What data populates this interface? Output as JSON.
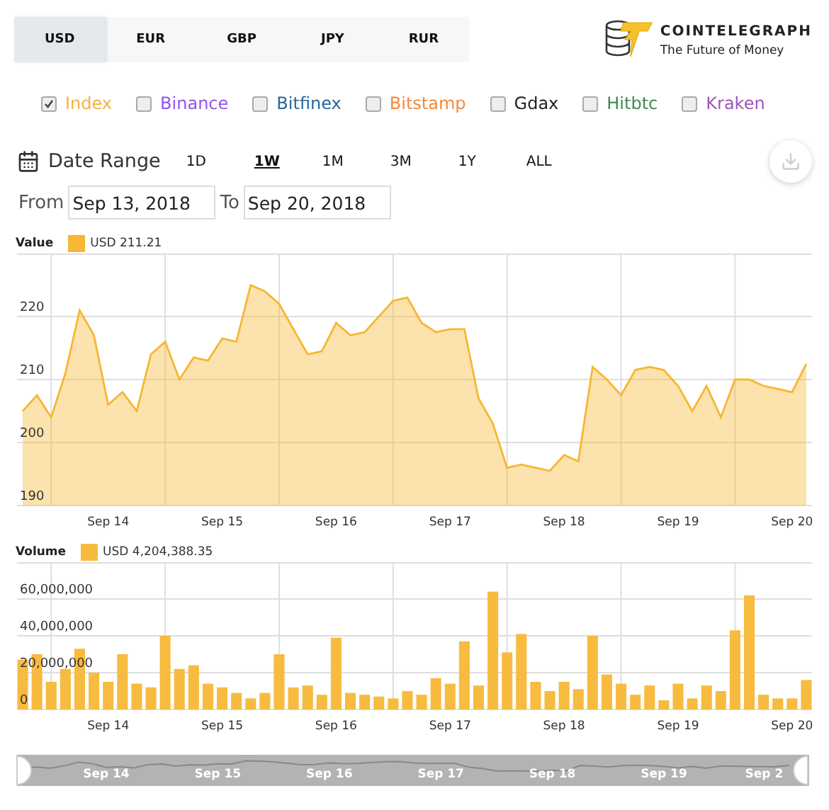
{
  "currency_tabs": [
    {
      "label": "USD",
      "selected": true
    },
    {
      "label": "EUR",
      "selected": false
    },
    {
      "label": "GBP",
      "selected": false
    },
    {
      "label": "JPY",
      "selected": false
    },
    {
      "label": "RUR",
      "selected": false
    }
  ],
  "logo": {
    "name": "COINTELEGRAPH",
    "tagline": "The Future of Money"
  },
  "exchanges": [
    {
      "label": "Index",
      "checked": true,
      "color": "#f6b042"
    },
    {
      "label": "Binance",
      "checked": false,
      "color": "#9353f0"
    },
    {
      "label": "Bitfinex",
      "checked": false,
      "color": "#2a679c"
    },
    {
      "label": "Bitstamp",
      "checked": false,
      "color": "#f5883b"
    },
    {
      "label": "Gdax",
      "checked": false,
      "color": "#222222"
    },
    {
      "label": "Hitbtc",
      "checked": false,
      "color": "#3d8b4b"
    },
    {
      "label": "Kraken",
      "checked": false,
      "color": "#9c58b8"
    }
  ],
  "date_range": {
    "label": "Date Range",
    "ranges": [
      {
        "label": "1D",
        "selected": false
      },
      {
        "label": "1W",
        "selected": true
      },
      {
        "label": "1M",
        "selected": false
      },
      {
        "label": "3M",
        "selected": false
      },
      {
        "label": "1Y",
        "selected": false
      },
      {
        "label": "ALL",
        "selected": false
      }
    ],
    "from_label": "From",
    "from": "Sep 13, 2018",
    "to_label": "To",
    "to": "Sep 20, 2018"
  },
  "value_chart": {
    "title": "Value",
    "reading": "211.21",
    "chart_data": {
      "type": "area",
      "grid": true,
      "ylim": [
        190,
        230
      ],
      "yticks": [
        190,
        200,
        210,
        220
      ],
      "categories": [
        null,
        null,
        null,
        null,
        null,
        null,
        "Sep 14",
        null,
        null,
        null,
        null,
        null,
        null,
        null,
        "Sep 15",
        null,
        null,
        null,
        null,
        null,
        null,
        null,
        "Sep 16",
        null,
        null,
        null,
        null,
        null,
        null,
        null,
        "Sep 17",
        null,
        null,
        null,
        null,
        null,
        null,
        null,
        "Sep 18",
        null,
        null,
        null,
        null,
        null,
        null,
        null,
        "Sep 19",
        null,
        null,
        null,
        null,
        null,
        null,
        null,
        "Sep 20",
        null
      ],
      "series": [
        {
          "name": "USD",
          "color": "#f7b733",
          "values": [
            205,
            207.5,
            204,
            211,
            221,
            217,
            206,
            208,
            205,
            214,
            216,
            210,
            213.5,
            213,
            216.5,
            216,
            225,
            224,
            222,
            218,
            214,
            214.5,
            219,
            217,
            217.5,
            220,
            222.5,
            223,
            219,
            217.5,
            218,
            218,
            207,
            203,
            196,
            196.5,
            196,
            195.5,
            198,
            197,
            212,
            210,
            207.5,
            211.5,
            212,
            211.5,
            209,
            205,
            209,
            204,
            210,
            210,
            209,
            208.5,
            208,
            212.5
          ]
        }
      ]
    }
  },
  "volume_chart": {
    "title": "Volume",
    "reading": "4,204,388.35",
    "chart_data": {
      "type": "bar",
      "grid": true,
      "ylim": [
        0,
        80000000
      ],
      "yticks": [
        {
          "value": 0,
          "label": "0"
        },
        {
          "value": 20000000,
          "label": "20,000,000"
        },
        {
          "value": 40000000,
          "label": "40,000,000"
        },
        {
          "value": 60000000,
          "label": "60,000,000"
        }
      ],
      "categories": [
        null,
        null,
        null,
        null,
        null,
        null,
        "Sep 14",
        null,
        null,
        null,
        null,
        null,
        null,
        null,
        "Sep 15",
        null,
        null,
        null,
        null,
        null,
        null,
        null,
        "Sep 16",
        null,
        null,
        null,
        null,
        null,
        null,
        null,
        "Sep 17",
        null,
        null,
        null,
        null,
        null,
        null,
        null,
        "Sep 18",
        null,
        null,
        null,
        null,
        null,
        null,
        null,
        "Sep 19",
        null,
        null,
        null,
        null,
        null,
        null,
        null,
        "Sep 20",
        null
      ],
      "series": [
        {
          "name": "USD",
          "color": "#f7bb3f",
          "values": [
            27000000,
            30000000,
            15000000,
            22000000,
            33000000,
            20000000,
            15000000,
            30000000,
            14000000,
            12000000,
            40000000,
            22000000,
            24000000,
            14000000,
            12000000,
            9000000,
            6000000,
            9000000,
            30000000,
            12000000,
            13000000,
            8000000,
            39000000,
            9000000,
            8000000,
            7000000,
            6000000,
            10000000,
            8000000,
            17000000,
            14000000,
            37000000,
            13000000,
            64000000,
            31000000,
            41000000,
            15000000,
            10000000,
            15000000,
            11000000,
            40000000,
            19000000,
            14000000,
            8000000,
            13000000,
            5000000,
            14000000,
            6000000,
            13000000,
            10000000,
            43000000,
            62000000,
            8000000,
            6000000,
            6000000,
            16000000
          ]
        }
      ]
    }
  },
  "navigator": {
    "labels": [
      "Sep 14",
      "Sep 15",
      "Sep 16",
      "Sep 17",
      "Sep 18",
      "Sep 19",
      "Sep 2"
    ]
  }
}
